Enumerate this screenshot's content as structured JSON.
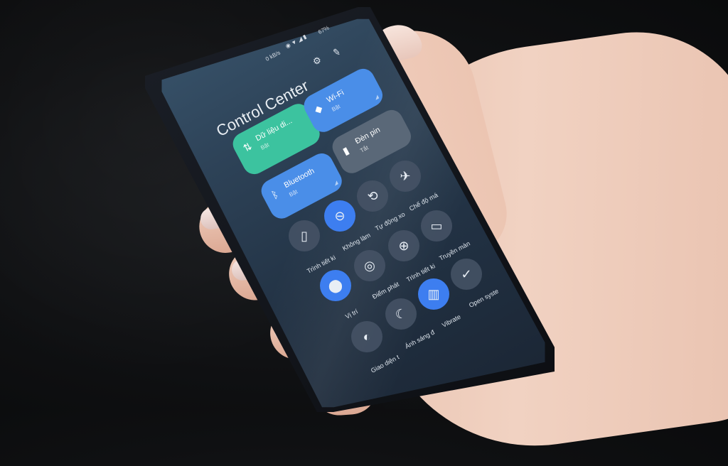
{
  "status_bar": {
    "speed": "0 kB/s",
    "battery": "67%"
  },
  "header": {
    "title": "Control Center",
    "settings_icon": "gear-icon",
    "edit_icon": "edit-icon"
  },
  "large_tiles": [
    {
      "key": "mobile_data",
      "label": "Dữ liệu di...",
      "sub": "Bật",
      "color": "#3cc39f",
      "icon": "data-arrows-icon"
    },
    {
      "key": "wifi",
      "label": "Wi-Fi",
      "sub": "Bật",
      "color": "#4a8ee8",
      "icon": "wifi-icon"
    },
    {
      "key": "flashlight",
      "label": "Đèn pin",
      "sub": "Tắt",
      "color": "#5a6878",
      "icon": "flashlight-icon"
    },
    {
      "key": "bluetooth",
      "label": "Bluetooth",
      "sub": "Bật",
      "color": "#4a8ee8",
      "icon": "bluetooth-icon"
    }
  ],
  "toggles": [
    {
      "key": "battery_saver",
      "label": "Trình tiết ki",
      "icon": "battery-icon",
      "active": false
    },
    {
      "key": "dnd",
      "label": "Không làm",
      "icon": "minus-circle-icon",
      "active": true
    },
    {
      "key": "auto_rotate",
      "label": "Tự động xo",
      "icon": "rotate-icon",
      "active": false
    },
    {
      "key": "airplane",
      "label": "Chế độ má",
      "icon": "airplane-icon",
      "active": false
    },
    {
      "key": "data_saver",
      "label": "Trình tiết ki",
      "icon": "data-saver-icon",
      "active": false
    },
    {
      "key": "cast",
      "label": "Truyền màn",
      "icon": "cast-icon",
      "active": false
    },
    {
      "key": "hotspot",
      "label": "Điểm phát",
      "icon": "hotspot-icon",
      "active": false
    },
    {
      "key": "location",
      "label": "Vị trí",
      "icon": "location-pin-icon",
      "active": true
    },
    {
      "key": "open_system",
      "label": "Open syste",
      "icon": "check-icon",
      "active": false
    },
    {
      "key": "vibrate",
      "label": "Vibrate",
      "icon": "vibrate-icon",
      "active": true
    },
    {
      "key": "night_light",
      "label": "Ánh sáng đ",
      "icon": "moon-icon",
      "active": false
    },
    {
      "key": "dark_theme",
      "label": "Giao diện t",
      "icon": "contrast-icon",
      "active": false
    }
  ]
}
